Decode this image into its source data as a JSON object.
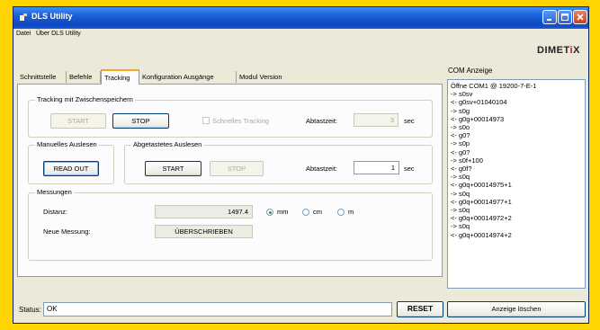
{
  "window": {
    "title": "DLS Utility",
    "logo_main": "DIMET",
    "logo_x": "i",
    "logo_end": "X"
  },
  "menu": [
    "Datei",
    "Über DLS Utility"
  ],
  "tabs": [
    "Schnittstelle",
    "Befehle",
    "Tracking",
    "Konfiguration Ausgänge",
    "Modul Version"
  ],
  "active_tab": "Tracking",
  "tracking": {
    "group_title": "Tracking mit Zwischenspeichern",
    "start_label": "START",
    "stop_label": "STOP",
    "schnell_label": "Schnelles Tracking",
    "schnell_checked": false,
    "abtastzeit_label": "Abtastzeit:",
    "abtastzeit_value": "3",
    "unit": "sec"
  },
  "manuell": {
    "group_title": "Manuelles Auslesen",
    "readout_label": "READ OUT"
  },
  "abgetastet": {
    "group_title": "Abgetastetes Auslesen",
    "start_label": "START",
    "stop_label": "STOP",
    "abtastzeit_label": "Abtastzeit:",
    "abtastzeit_value": "1",
    "unit": "sec"
  },
  "messungen": {
    "group_title": "Messungen",
    "distanz_label": "Distanz:",
    "distanz_value": "1497.4",
    "units": [
      "mm",
      "cm",
      "m"
    ],
    "selected_unit": "mm",
    "neue_label": "Neue Messung:",
    "neue_value": "ÜBERSCHRIEBEN"
  },
  "com": {
    "title": "COM Anzeige",
    "lines": [
      "Öffne COM1 @ 19200-7-E-1",
      "-> s0sv",
      "<- g0sv+01040104",
      "-> s0g",
      "<- g0g+00014973",
      "-> s0o",
      "<- g0?",
      "-> s0p",
      "<- g0?",
      "-> s0f+100",
      "<- g0f?",
      "-> s0q",
      "<- g0q+00014975+1",
      "-> s0q",
      "<- g0q+00014977+1",
      "-> s0q",
      "<- g0q+00014972+2",
      "-> s0q",
      "<- g0q+00014974+2"
    ]
  },
  "status": {
    "label": "Status:",
    "value": "OK"
  },
  "buttons": {
    "reset": "RESET",
    "clear": "Anzeige löschen"
  }
}
